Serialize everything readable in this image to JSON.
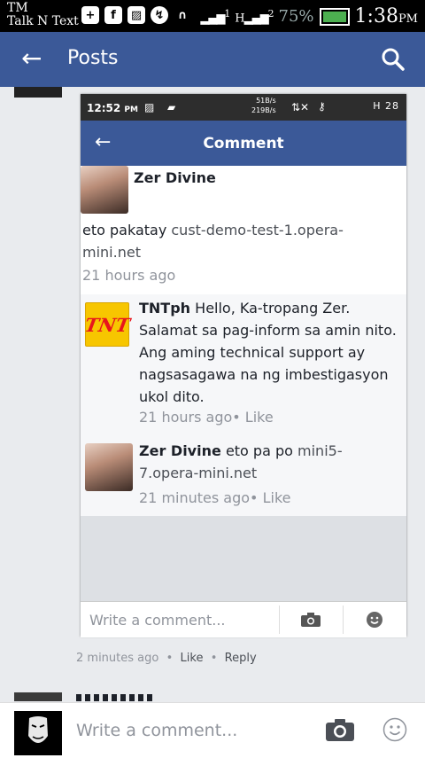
{
  "status_bar": {
    "carrier_line1": "TM",
    "carrier_line2": "Talk N Text",
    "icons": [
      "plus-icon",
      "facebook-icon",
      "image-icon",
      "messenger-icon",
      "headphones-icon"
    ],
    "signal1": "1",
    "signal2": "2",
    "battery_text": "75%",
    "time": "1:38",
    "ampm": "PM"
  },
  "app_bar": {
    "title": "Posts"
  },
  "screenshot": {
    "status_time": "12:52",
    "status_ampm": "PM",
    "speed_up": "51B/s",
    "speed_down": "219B/s",
    "status_right": "H 28",
    "header_title": "Comment",
    "comment": {
      "author": "Zer Divine",
      "text_prefix": "eto pakatay ",
      "link": "cust-demo-test-1.opera-mini.net",
      "time": "21 hours ago"
    },
    "replies": [
      {
        "author": "TNTph",
        "text": "Hello, Ka-tropang Zer. Salamat sa pag-inform sa amin nito. Ang aming technical support ay nagsasagawa na ng imbestigasyon ukol dito.",
        "time": "21 hours ago",
        "like": "Like",
        "logo_text": "TNT"
      },
      {
        "author": "Zer Divine",
        "text_prefix": "eto pa po ",
        "link": "mini5-7.opera-mini.net",
        "time": "21 minutes ago",
        "like": "Like"
      }
    ],
    "composer_placeholder": "Write a comment..."
  },
  "meta": {
    "time": "2 minutes ago",
    "like": "Like",
    "reply": "Reply",
    "sep": "•"
  },
  "composer": {
    "placeholder": "Write a comment..."
  }
}
